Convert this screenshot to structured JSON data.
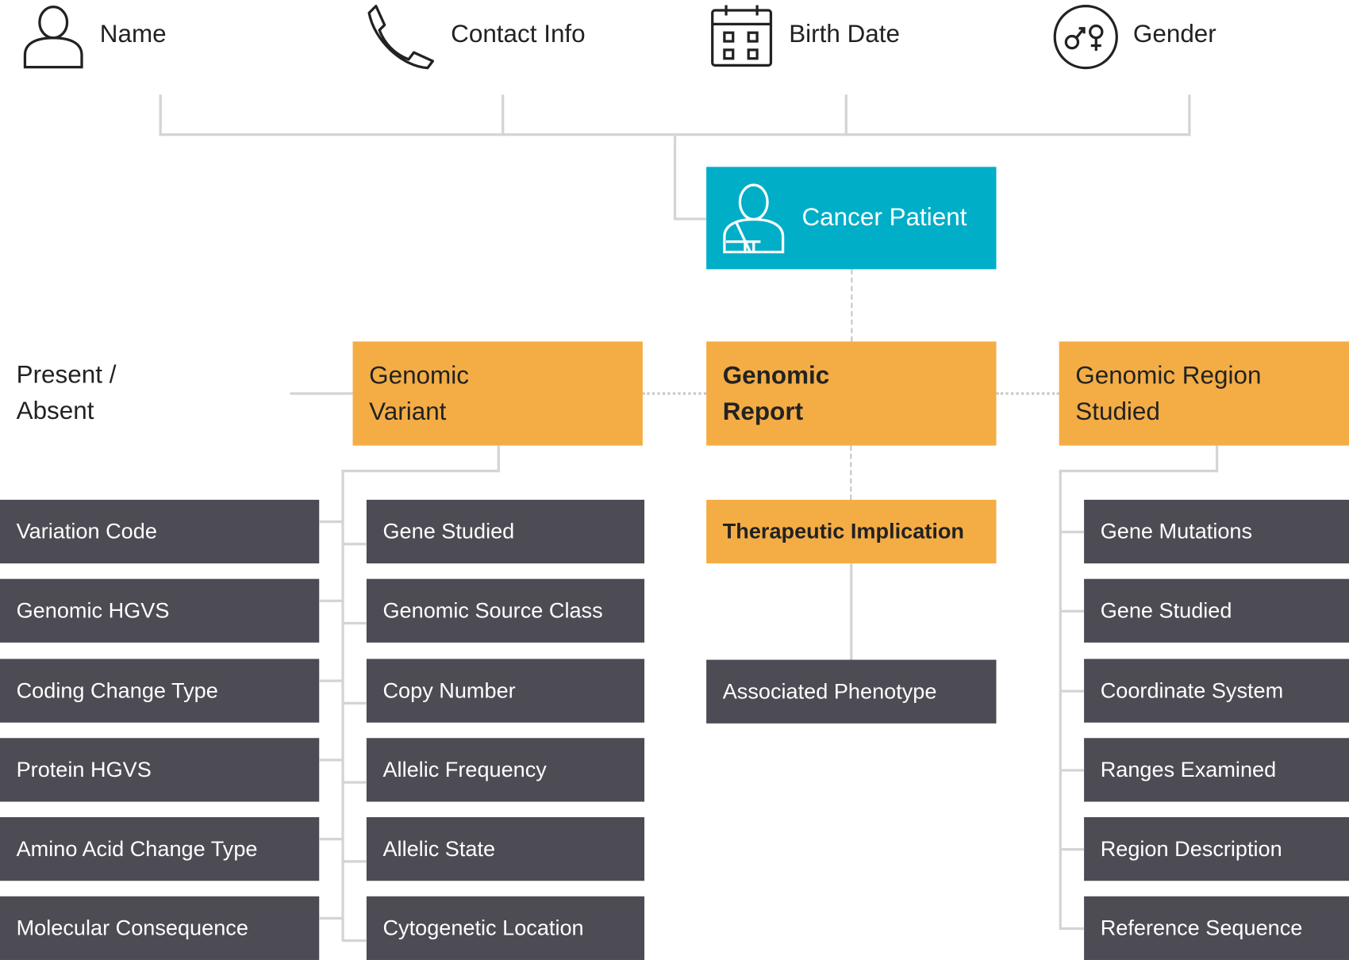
{
  "attributes": [
    {
      "label": "Name",
      "icon": "person-icon"
    },
    {
      "label": "Contact Info",
      "icon": "phone-icon"
    },
    {
      "label": "Birth Date",
      "icon": "calendar-icon"
    },
    {
      "label": "Gender",
      "icon": "gender-icon"
    }
  ],
  "patient": {
    "label": "Cancer Patient",
    "icon": "patient-icon",
    "color": "#00AEC7"
  },
  "present_absent": {
    "line1": "Present /",
    "line2": "Absent"
  },
  "categories": {
    "color": "#F4AD45",
    "genomic_variant": {
      "line1": "Genomic",
      "line2": "Variant"
    },
    "genomic_report": {
      "line1": "Genomic",
      "line2": "Report"
    },
    "genomic_region": {
      "line1": "Genomic Region",
      "line2": "Studied"
    }
  },
  "variant_left": [
    "Variation Code",
    "Genomic HGVS",
    "Coding Change Type",
    "Protein HGVS",
    "Amino Acid Change Type",
    "Molecular Consequence"
  ],
  "variant_right": [
    "Gene Studied",
    "Genomic Source Class",
    "Copy Number",
    "Allelic Frequency",
    "Allelic State",
    "Cytogenetic Location"
  ],
  "report": {
    "therapeutic": "Therapeutic Implication",
    "phenotype": "Associated Phenotype"
  },
  "region_items": [
    "Gene Mutations",
    "Gene Studied",
    "Coordinate System",
    "Ranges Examined",
    "Region Description",
    "Reference Sequence"
  ],
  "item_color": "#4D4B53"
}
